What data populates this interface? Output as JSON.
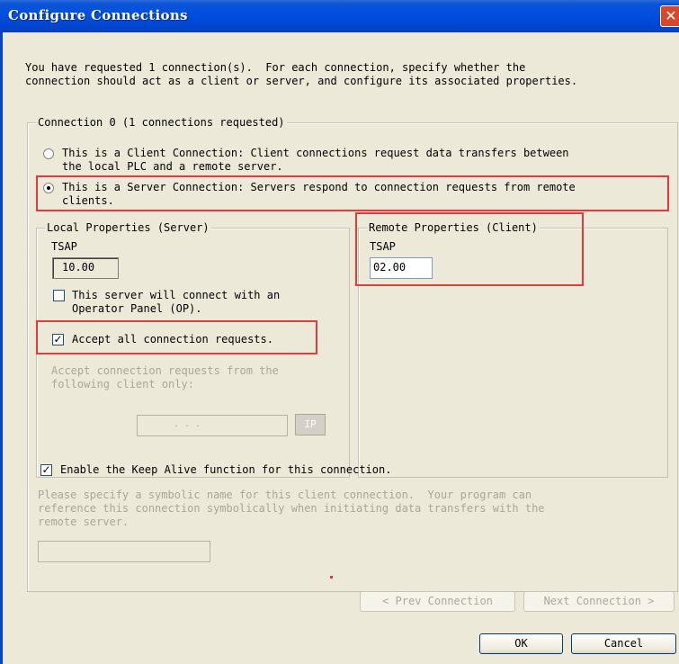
{
  "window": {
    "title": "Configure Connections",
    "close_glyph": "✕"
  },
  "intro": {
    "line1": "You have requested 1 connection(s).  For each connection, specify whether the",
    "line2": "connection should act as a client or server, and configure its associated properties."
  },
  "connection_group": {
    "label": "Connection 0 (1 connections requested)",
    "client_option": {
      "line1": "This is a Client Connection: Client connections request data transfers between",
      "line2": "the local PLC and a remote server.",
      "selected": false
    },
    "server_option": {
      "line1": "This is a Server Connection: Servers respond to connection requests from remote",
      "line2": "clients.",
      "selected": true
    }
  },
  "local_properties": {
    "label": "Local Properties (Server)",
    "tsap_label": "TSAP",
    "tsap_value": "10.00",
    "op_panel_line1": "This server will connect with an",
    "op_panel_line2": "Operator Panel (OP).",
    "op_panel_checked": false,
    "accept_all_label": "Accept all connection requests.",
    "accept_all_checked": true,
    "accept_from_line1": "Accept connection requests from the",
    "accept_from_line2": "following client only:",
    "ip_value": ".    .    .",
    "ip_button_label": "IP"
  },
  "remote_properties": {
    "label": "Remote Properties (Client)",
    "tsap_label": "TSAP",
    "tsap_value": "02.00"
  },
  "keep_alive": {
    "label": "Enable the Keep Alive function for this connection.",
    "checked": true
  },
  "symbolic": {
    "line1": "Please specify a symbolic name for this client connection.  Your program can",
    "line2": "reference this connection symbolically when initiating data transfers with the",
    "line3": "remote server.",
    "value": ""
  },
  "buttons": {
    "prev": "< Prev Connection",
    "next": "Next Connection >",
    "ok": "OK",
    "cancel": "Cancel"
  },
  "colors": {
    "highlight": "#e53a3a",
    "titlebar": "#0050e0",
    "dialog_bg": "#ece9d8"
  }
}
